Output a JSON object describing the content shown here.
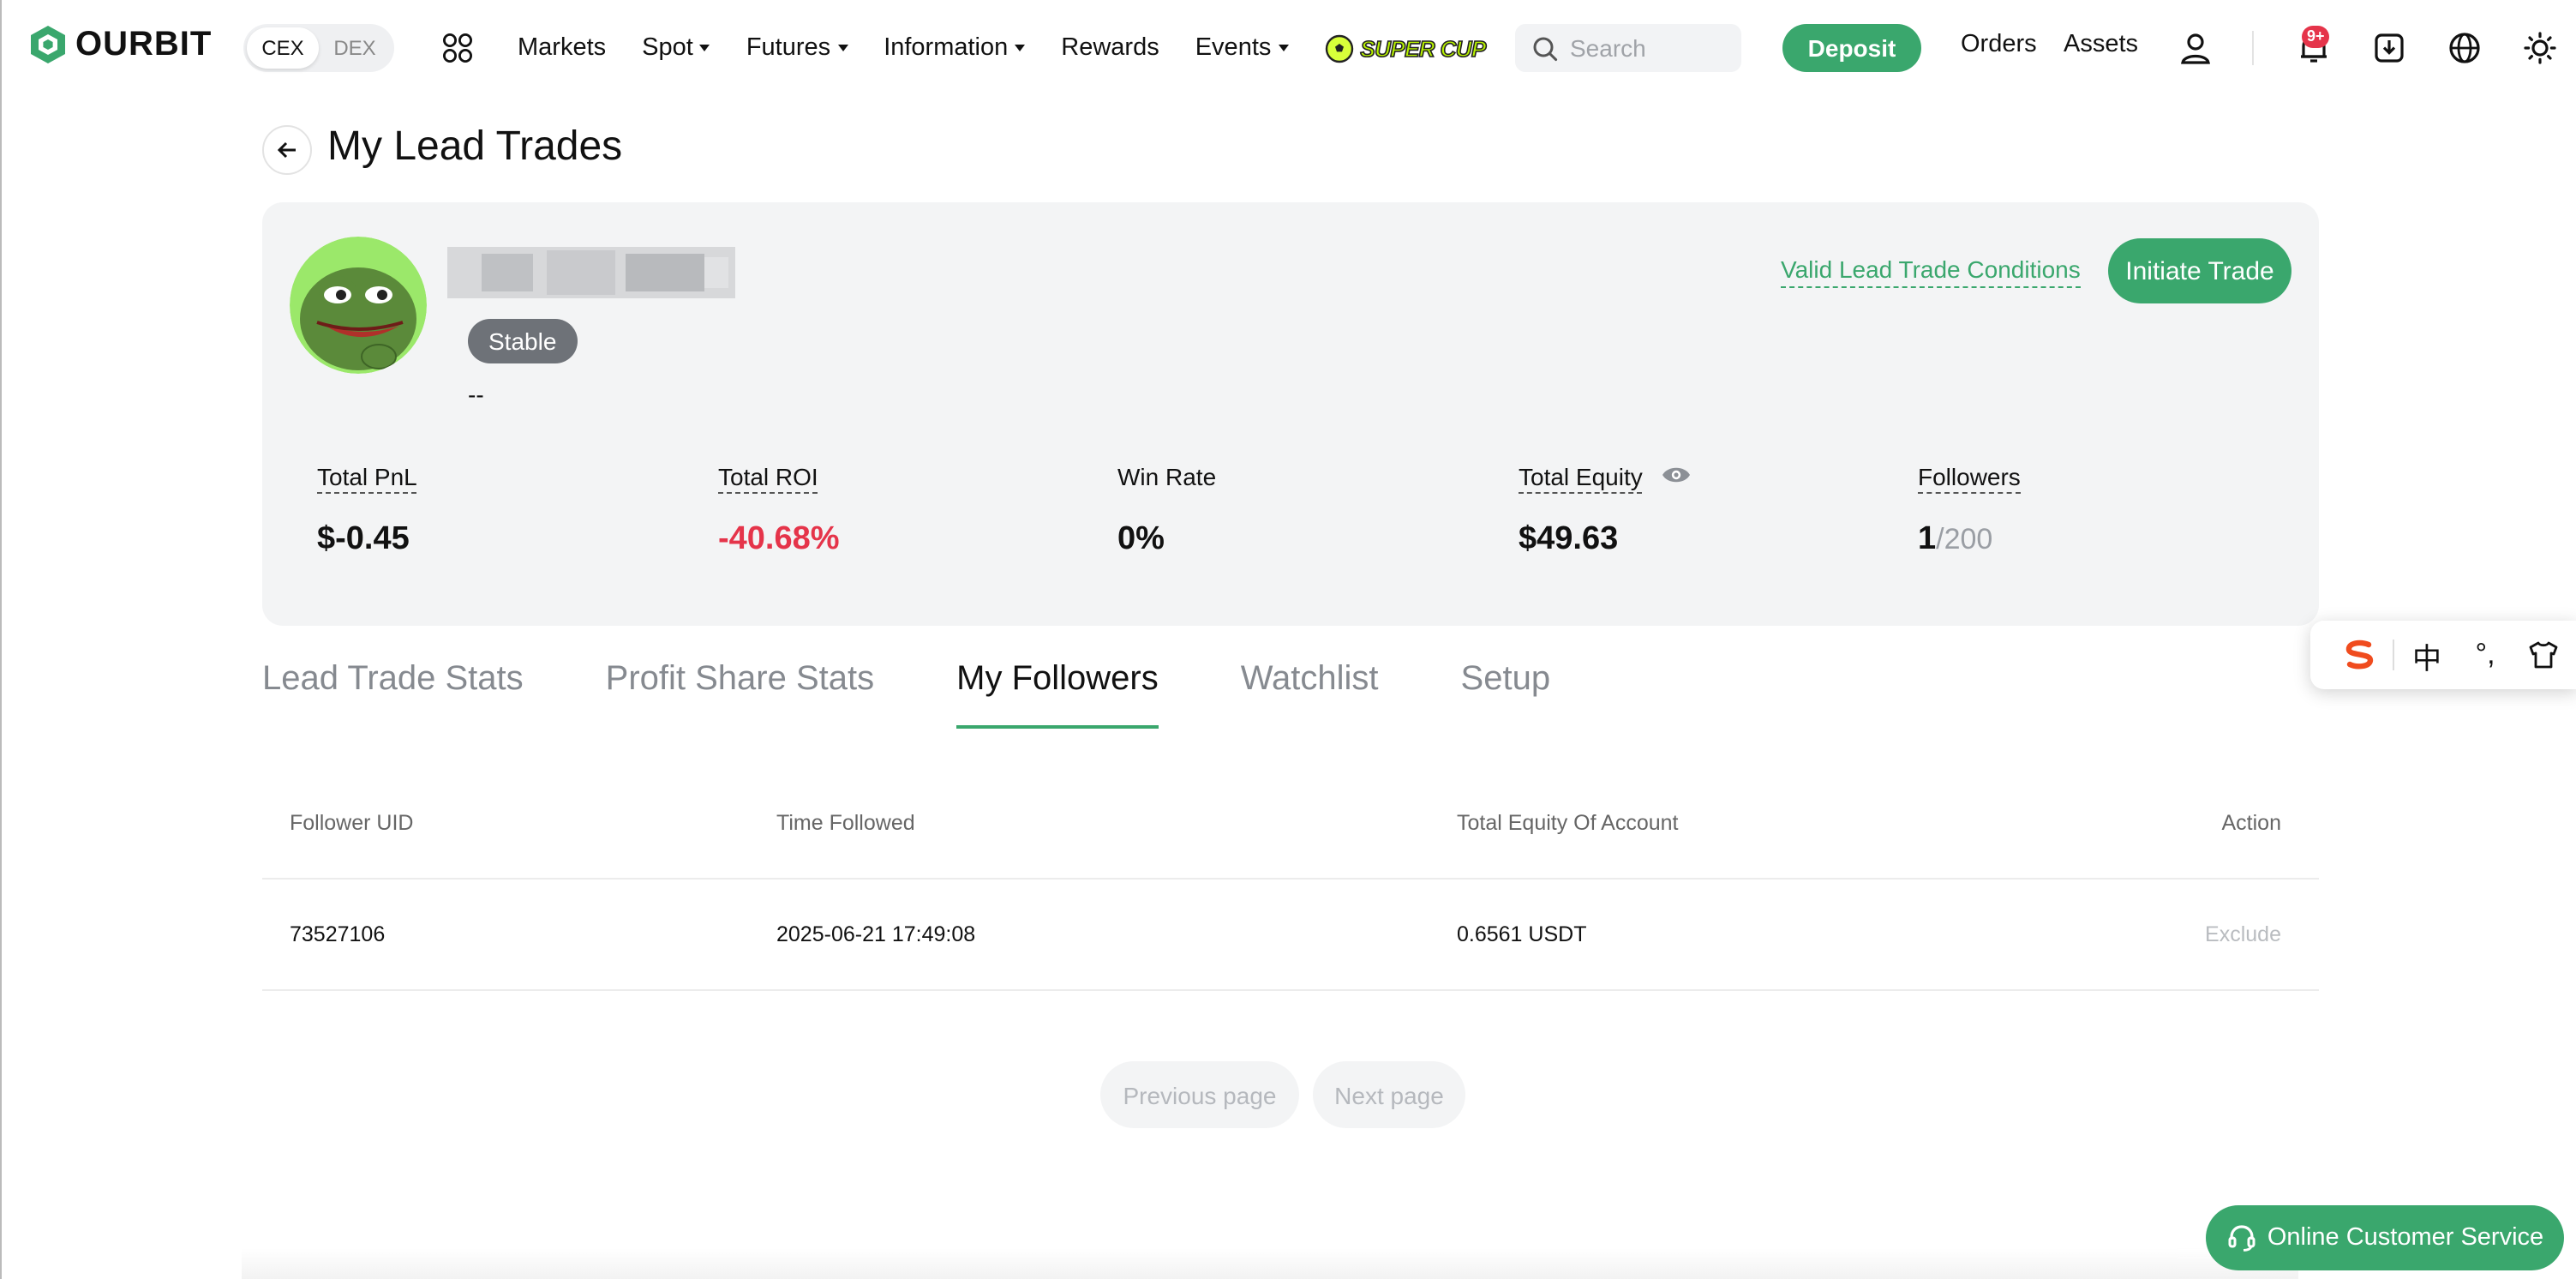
{
  "nav": {
    "logo_text": "OURBIT",
    "segments": [
      "CEX",
      "DEX"
    ],
    "active_segment": "CEX",
    "menu": [
      {
        "label": "Markets",
        "dropdown": false
      },
      {
        "label": "Spot",
        "dropdown": true
      },
      {
        "label": "Futures",
        "dropdown": true
      },
      {
        "label": "Information",
        "dropdown": true
      },
      {
        "label": "Rewards",
        "dropdown": false
      },
      {
        "label": "Events",
        "dropdown": true
      }
    ],
    "promo_label": "SUPER CUP",
    "search_placeholder": "Search",
    "deposit_label": "Deposit",
    "orders_label": "Orders",
    "assets_label": "Assets",
    "notification_badge": "9+",
    "icons": [
      "apps-icon",
      "search-icon",
      "user-icon",
      "bell-icon",
      "download-icon",
      "globe-icon",
      "sun-icon"
    ]
  },
  "page": {
    "title": "My Lead Trades"
  },
  "profile": {
    "tag": "Stable",
    "description": "--",
    "valid_link": "Valid Lead Trade Conditions",
    "initiate_label": "Initiate Trade"
  },
  "stats": {
    "total_pnl": {
      "label": "Total PnL",
      "value": "$-0.45"
    },
    "total_roi": {
      "label": "Total ROI",
      "value": "-40.68%"
    },
    "win_rate": {
      "label": "Win Rate",
      "value": "0%"
    },
    "total_equity": {
      "label": "Total Equity",
      "value": "$49.63"
    },
    "followers": {
      "label": "Followers",
      "value": "1",
      "max": "/200"
    }
  },
  "tabs": [
    {
      "label": "Lead Trade Stats",
      "active": false
    },
    {
      "label": "Profit Share Stats",
      "active": false
    },
    {
      "label": "My Followers",
      "active": true
    },
    {
      "label": "Watchlist",
      "active": false
    },
    {
      "label": "Setup",
      "active": false
    }
  ],
  "table": {
    "columns": [
      "Follower UID",
      "Time Followed",
      "Total Equity Of Account",
      "Action"
    ],
    "rows": [
      {
        "uid": "73527106",
        "time": "2025-06-21 17:49:08",
        "equity": "0.6561 USDT",
        "action": "Exclude"
      }
    ]
  },
  "pager": {
    "prev_label": "Previous page",
    "next_label": "Next page"
  },
  "ime_toolbar": {
    "items": [
      "S",
      "中",
      "°,",
      "shirt-icon"
    ]
  },
  "service": {
    "label": "Online Customer Service"
  },
  "colors": {
    "accent": "#3aa76d",
    "negative": "#e5344a",
    "card_bg": "#f3f4f5"
  }
}
